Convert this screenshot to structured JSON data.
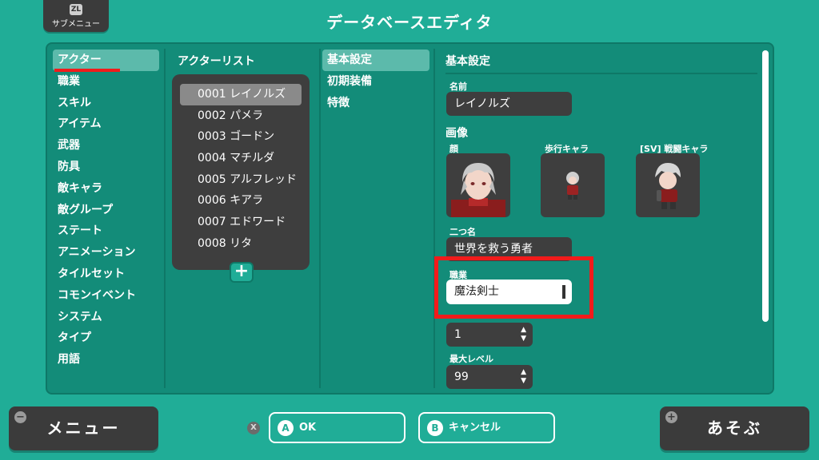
{
  "header": {
    "title": "データベースエディタ",
    "submenu_badge": "ZL",
    "submenu_label": "サブメニュー"
  },
  "menu": {
    "items": [
      "アクター",
      "職業",
      "スキル",
      "アイテム",
      "武器",
      "防具",
      "敵キャラ",
      "敵グループ",
      "ステート",
      "アニメーション",
      "タイルセット",
      "コモンイベント",
      "システム",
      "タイプ",
      "用語"
    ],
    "selected": "アクター"
  },
  "actor_list": {
    "header": "アクターリスト",
    "items": [
      "0001 レイノルズ",
      "0002 パメラ",
      "0003 ゴードン",
      "0004 マチルダ",
      "0005 アルフレッド",
      "0006 キアラ",
      "0007 エドワード",
      "0008 リタ"
    ],
    "selected": "0001 レイノルズ",
    "add_label": "+"
  },
  "sub_tabs": {
    "items": [
      "基本設定",
      "初期装備",
      "特徴"
    ],
    "selected": "基本設定"
  },
  "detail": {
    "title": "基本設定",
    "name_label": "名前",
    "name_value": "レイノルズ",
    "image_section": "画像",
    "face_label": "顔",
    "walk_label": "歩行キャラ",
    "sv_label": "[SV] 戦闘キャラ",
    "nickname_label": "二つ名",
    "nickname_value": "世界を救う勇者",
    "class_label": "職業",
    "class_value": "魔法剣士",
    "initial_level_value": "1",
    "max_level_label": "最大レベル",
    "max_level_value": "99"
  },
  "footer": {
    "menu_button": "メニュー",
    "menu_badge": "−",
    "x_badge": "X",
    "ok_badge": "A",
    "ok_label": "OK",
    "cancel_badge": "B",
    "cancel_label": "キャンセル",
    "play_button": "あそぶ",
    "play_badge": "+"
  },
  "colors": {
    "background": "#20ad97",
    "panel": "#138c79",
    "highlight_red": "#f11b1b",
    "dark_box": "#3e3e3e"
  }
}
